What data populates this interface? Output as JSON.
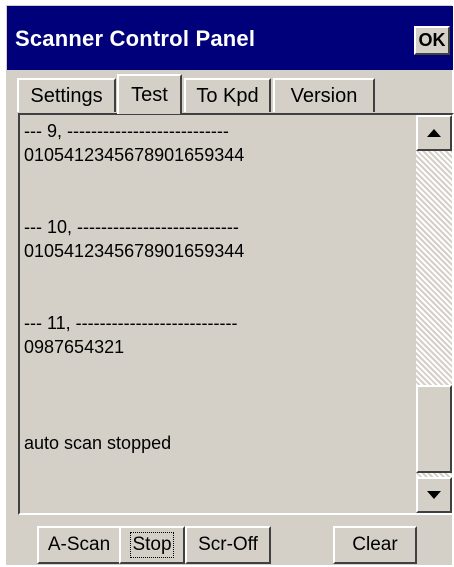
{
  "window": {
    "title": "Scanner Control Panel",
    "ok_label": "OK"
  },
  "tabs": [
    {
      "label": "Settings"
    },
    {
      "label": "Test",
      "active": true
    },
    {
      "label": "To Kpd"
    },
    {
      "label": "Version"
    }
  ],
  "log": {
    "lines": [
      "--- 9, ---------------------------",
      "01054123456789016​59344",
      "",
      "",
      "--- 10, ---------------------------",
      "01054123456789016​59344",
      "",
      "",
      "--- 11, ---------------------------",
      "0987654321",
      "",
      "",
      "",
      "auto scan stopped"
    ]
  },
  "scrollbar": {
    "up_icon": "arrow-up-icon",
    "down_icon": "arrow-down-icon"
  },
  "buttons": {
    "ascan": "A-Scan",
    "stop": "Stop",
    "scroff": "Scr-Off",
    "clear": "Clear"
  }
}
